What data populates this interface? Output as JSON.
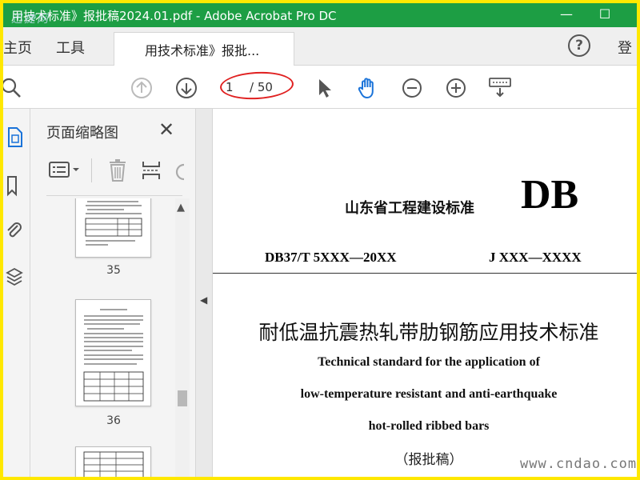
{
  "window": {
    "title": "用技术标准》报批稿2024.01.pdf - Adobe Acrobat Pro DC",
    "overlay_text": "迅捷网",
    "minimize_label": "—",
    "maximize_label": "☐"
  },
  "menubar": {
    "home_label": "主页",
    "tools_label": "工具",
    "doc_tab_label": "用技术标准》报批...",
    "help_label": "?",
    "login_label": "登"
  },
  "toolbar": {
    "current_page": "1",
    "page_total": "/ 50",
    "tools": [
      "search-icon",
      "page-up-icon",
      "page-down-icon",
      "select-pointer-icon",
      "hand-tool-icon",
      "zoom-out-icon",
      "zoom-in-icon",
      "keyboard-icon"
    ]
  },
  "left_rail": {
    "icons": [
      "page-thumbnails-icon",
      "bookmarks-icon",
      "attachments-icon",
      "layers-icon"
    ]
  },
  "thumbnails_panel": {
    "title": "页面缩略图",
    "close_label": "✕",
    "pages": [
      {
        "number": "35"
      },
      {
        "number": "36"
      }
    ]
  },
  "document": {
    "header_cn": "山东省工程建设标准",
    "header_db": "DB",
    "code_left": "DB37/T 5XXX—20XX",
    "code_right": "J XXX—XXXX",
    "title_cn": "耐低温抗震热轧带肋钢筋应用技术标准",
    "title_en_line1": "Technical standard for the application of",
    "title_en_line2": "low-temperature resistant and anti-earthquake",
    "title_en_line3": "hot-rolled ribbed bars",
    "subtitle": "（报批稿）"
  },
  "watermark": "www.cndao.com",
  "colors": {
    "titlebar": "#1d9e44",
    "highlight_ring": "#e02020",
    "frame_border": "#ffe800",
    "hand_tool": "#1a73d9"
  }
}
